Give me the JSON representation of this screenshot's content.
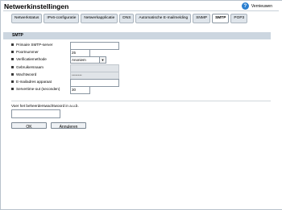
{
  "header": {
    "title": "Netwerkinstellingen",
    "help_label": "Vernieuwen"
  },
  "tabs": [
    {
      "label": "Netwerkstatus"
    },
    {
      "label": "IPv6-configuratie"
    },
    {
      "label": "Netwerkapplicatie"
    },
    {
      "label": "DNS"
    },
    {
      "label": "Automatische E-mailmelding"
    },
    {
      "label": "SNMP"
    },
    {
      "label": "SMTP",
      "active": true
    },
    {
      "label": "POP3"
    }
  ],
  "section": {
    "title": "SMTP"
  },
  "fields": {
    "primary_server": {
      "label": "Primaire SMTP-server",
      "value": ""
    },
    "port": {
      "label": "Poortnummer",
      "value": "25"
    },
    "auth_method": {
      "label": "Verificatiemethode",
      "value": "Anoniem"
    },
    "username": {
      "label": "Gebruikersnaam",
      "value": ""
    },
    "password": {
      "label": "Wachtwoord",
      "value": "••••••••"
    },
    "email_device": {
      "label": "E-mailadres apparaat",
      "value": ""
    },
    "timeout": {
      "label": "Servertime-out (seconden)",
      "value": "30"
    }
  },
  "admin_password": {
    "label": "Voer het beheerderswachtwoord in a.u.b.",
    "value": ""
  },
  "buttons": {
    "ok": "OK",
    "cancel": "Annuleren"
  },
  "colors": {
    "section_bar": "#ccd6e0",
    "tab_bg": "#dfe5eb",
    "help_icon": "#2a7fd0"
  },
  "icons": {
    "help": "question-circle-icon",
    "dropdown": "chevron-down-icon"
  }
}
